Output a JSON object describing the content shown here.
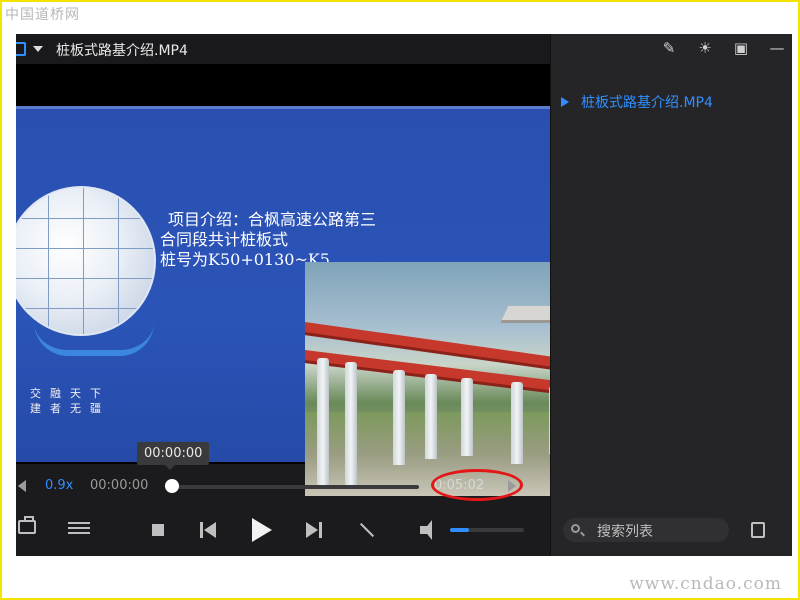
{
  "watermark": {
    "top": "中国道桥网",
    "bottom": "www.cndao.com"
  },
  "window": {
    "title": "桩板式路基介绍.MP4"
  },
  "slide": {
    "line1": "项目介绍：合枫高速公路第三",
    "line2": "合同段共计桩板式",
    "line3": "桩号为K50+0130~K5",
    "motto_row1": "交融天下",
    "motto_row2": "建者无疆"
  },
  "player": {
    "hover_time": "00:00:00",
    "speed": "0.9x",
    "current_time": "00:00:00",
    "total_time": "0:05:02",
    "progress": 0,
    "volume": 0.25,
    "accent_color": "#2f8fff",
    "highlight_color": "#e31717"
  },
  "playlist": {
    "items": [
      {
        "label": "桩板式路基介绍.MP4",
        "active": true
      }
    ],
    "search_placeholder": "搜索列表",
    "toolbar_icons": [
      "edit-icon",
      "bulb-icon",
      "pip-icon",
      "minimize-icon"
    ]
  }
}
